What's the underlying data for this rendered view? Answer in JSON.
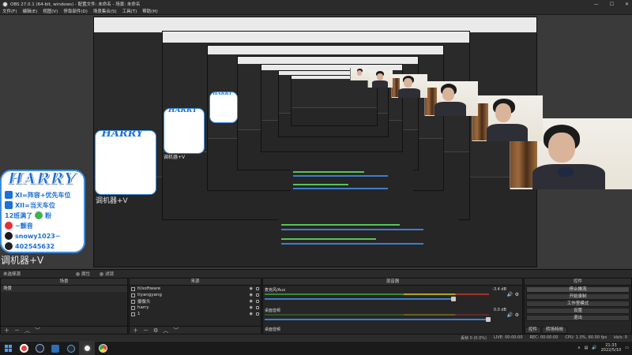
{
  "window": {
    "title": "OBS 27.0.1 (64-bit, windows) - 配置文件: 未命名 - 场景: 未命名",
    "controls": [
      "—",
      "☐",
      "✕"
    ]
  },
  "menu": [
    "文件(F)",
    "编辑(E)",
    "视图(V)",
    "停靠部件(D)",
    "场景集合(S)",
    "工具(T)",
    "帮助(H)"
  ],
  "overlay": {
    "logo": "HARRY",
    "lines": [
      "XI=阵容+优先车位",
      "XII=当天车位",
      "12班满了",
      "粉",
      "~颤音",
      "snowy1023~",
      "402545632"
    ],
    "tuner": "调机器+V"
  },
  "dock": {
    "no_scene": "未选择源",
    "props_label": "属性",
    "filters_label": "滤镜"
  },
  "scenes": {
    "header": "场景",
    "items": [
      "场景"
    ]
  },
  "sources": {
    "header": "来源",
    "items": [
      {
        "name": "tl/software"
      },
      {
        "name": "tiyangyang"
      },
      {
        "name": "摄像头"
      },
      {
        "name": "harry"
      },
      {
        "name": "1"
      }
    ]
  },
  "mixer": {
    "header": "混音器",
    "channels": [
      {
        "name": "麦克风/Aux",
        "db": "-3.4 dB",
        "level": 0.62
      },
      {
        "name": "桌面音频",
        "db": "0.0 dB",
        "level": 0.0
      },
      {
        "name": "桌面音频",
        "db": "",
        "level": 0.0
      }
    ]
  },
  "controls": {
    "header": "控件",
    "buttons": [
      "停止推流",
      "开始录制",
      "工作室模式",
      "设置",
      "退出"
    ],
    "tabs": [
      "控件",
      "转场特效"
    ]
  },
  "status": {
    "dropped": "丢帧 0 (0.0%)",
    "live": "LIVE: 00:00:00",
    "rec": "REC: 00:00:00",
    "cpu": "CPU: 1.0%, 60.00 fps",
    "kbps": "kb/s: 0"
  },
  "taskbar": {
    "time": "21:33",
    "date": "2022/5/10"
  }
}
